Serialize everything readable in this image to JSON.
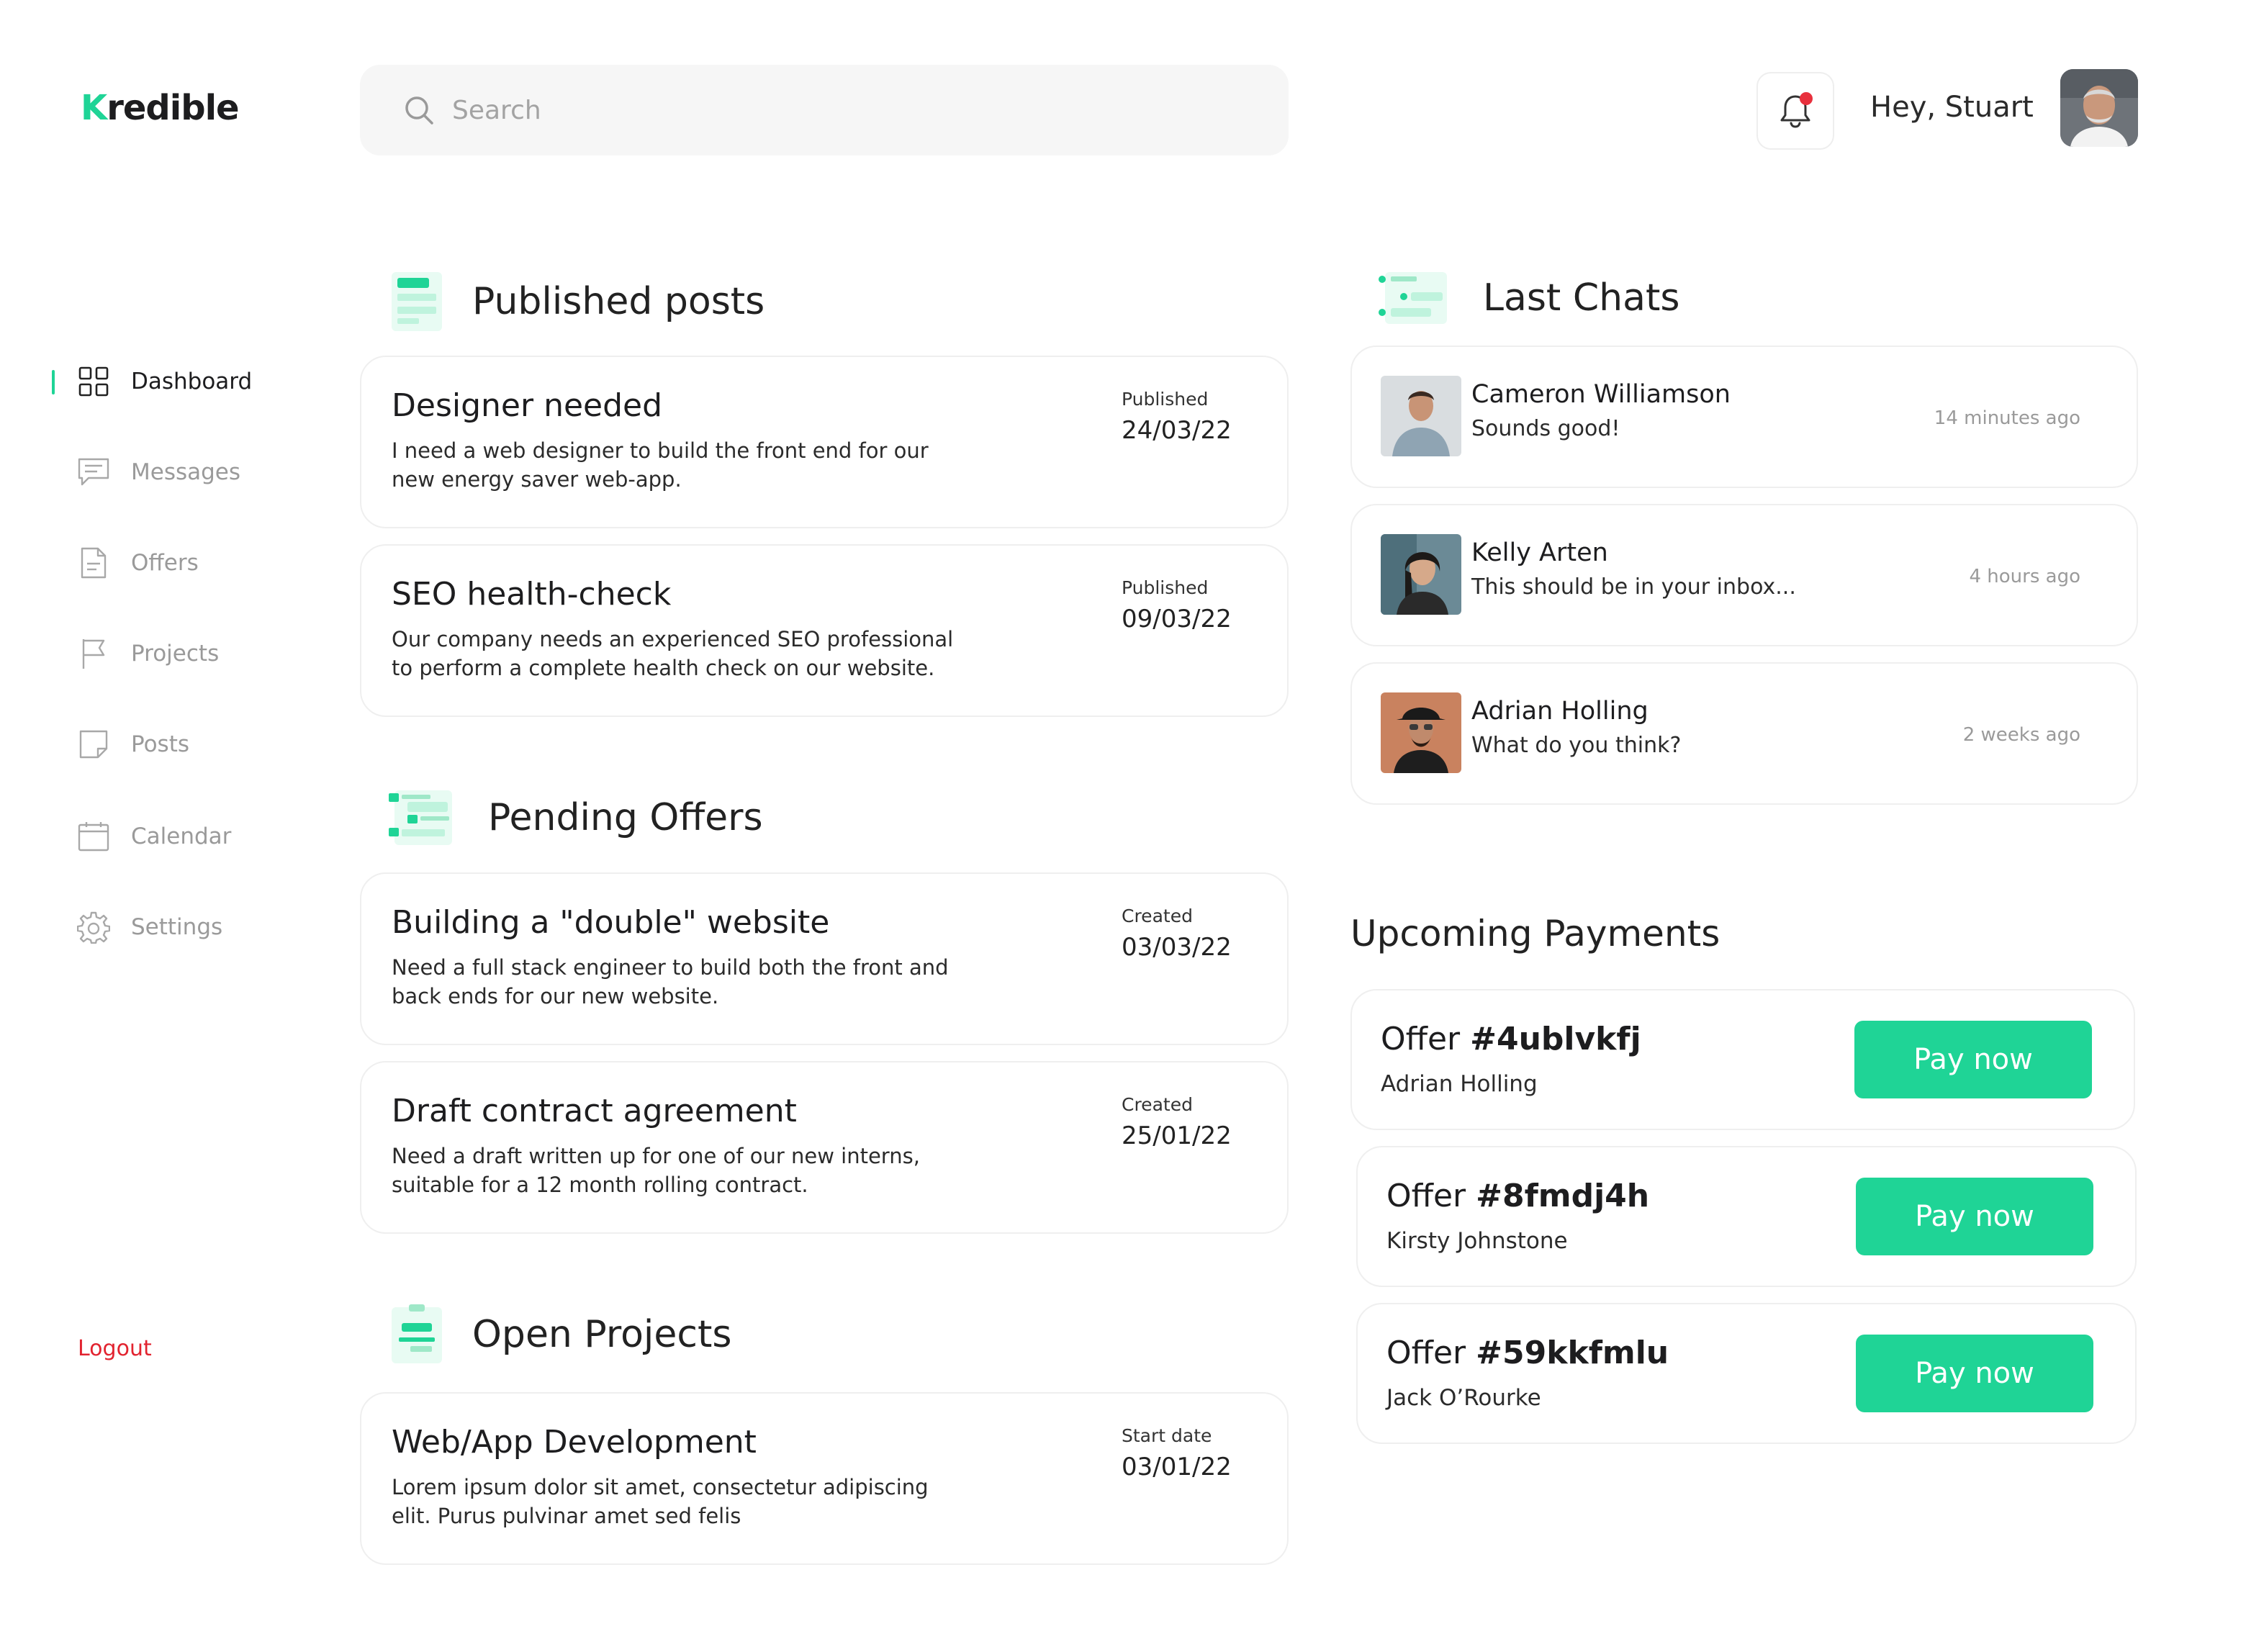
{
  "brand": {
    "logo_text_rest": "redible",
    "logo_letter": "K",
    "accent": "#1fd496"
  },
  "search": {
    "placeholder": "Search"
  },
  "header": {
    "greeting": "Hey, Stuart",
    "notification_dot_color": "#e8303d"
  },
  "sidebar": {
    "items": [
      {
        "label": "Dashboard",
        "icon": "grid-icon",
        "active": true
      },
      {
        "label": "Messages",
        "icon": "message-icon",
        "active": false
      },
      {
        "label": "Offers",
        "icon": "document-icon",
        "active": false
      },
      {
        "label": "Projects",
        "icon": "flag-icon",
        "active": false
      },
      {
        "label": "Posts",
        "icon": "note-icon",
        "active": false
      },
      {
        "label": "Calendar",
        "icon": "calendar-icon",
        "active": false
      },
      {
        "label": "Settings",
        "icon": "gear-icon",
        "active": false
      }
    ],
    "logout": "Logout"
  },
  "published_posts": {
    "title": "Published posts",
    "items": [
      {
        "title": "Designer needed",
        "desc": "I need a web designer to build the front end for our new energy saver web-app.",
        "label": "Published",
        "date": "24/03/22"
      },
      {
        "title": "SEO health-check",
        "desc": "Our company needs an experienced SEO professional to perform a complete health check on our website.",
        "label": "Published",
        "date": "09/03/22"
      }
    ]
  },
  "pending_offers": {
    "title": "Pending Offers",
    "items": [
      {
        "title": "Building a \"double\" website",
        "desc": "Need a full stack engineer to build both the front and back ends for our new website.",
        "label": "Created",
        "date": "03/03/22"
      },
      {
        "title": "Draft contract agreement",
        "desc": "Need a draft written up for one of our new interns, suitable for a 12 month rolling contract.",
        "label": "Created",
        "date": "25/01/22"
      }
    ]
  },
  "open_projects": {
    "title": "Open Projects",
    "items": [
      {
        "title": "Web/App Development",
        "desc": "Lorem ipsum dolor sit amet, consectetur adipiscing elit. Purus pulvinar amet sed felis",
        "label": "Start date",
        "date": "03/01/22"
      }
    ]
  },
  "last_chats": {
    "title": "Last Chats",
    "items": [
      {
        "name": "Cameron Williamson",
        "message": "Sounds good!",
        "time": "14 minutes ago"
      },
      {
        "name": "Kelly Arten",
        "message": "This should be in your inbox...",
        "time": "4 hours ago"
      },
      {
        "name": "Adrian Holling",
        "message": "What do you think?",
        "time": "2 weeks ago"
      }
    ]
  },
  "upcoming_payments": {
    "title": "Upcoming Payments",
    "offer_prefix": "Offer ",
    "button_label": "Pay now",
    "items": [
      {
        "offer_id": "#4ublvkfj",
        "name": "Adrian Holling"
      },
      {
        "offer_id": "#8fmdj4h",
        "name": "Kirsty Johnstone"
      },
      {
        "offer_id": "#59kkfmlu",
        "name": "Jack O’Rourke"
      }
    ]
  }
}
